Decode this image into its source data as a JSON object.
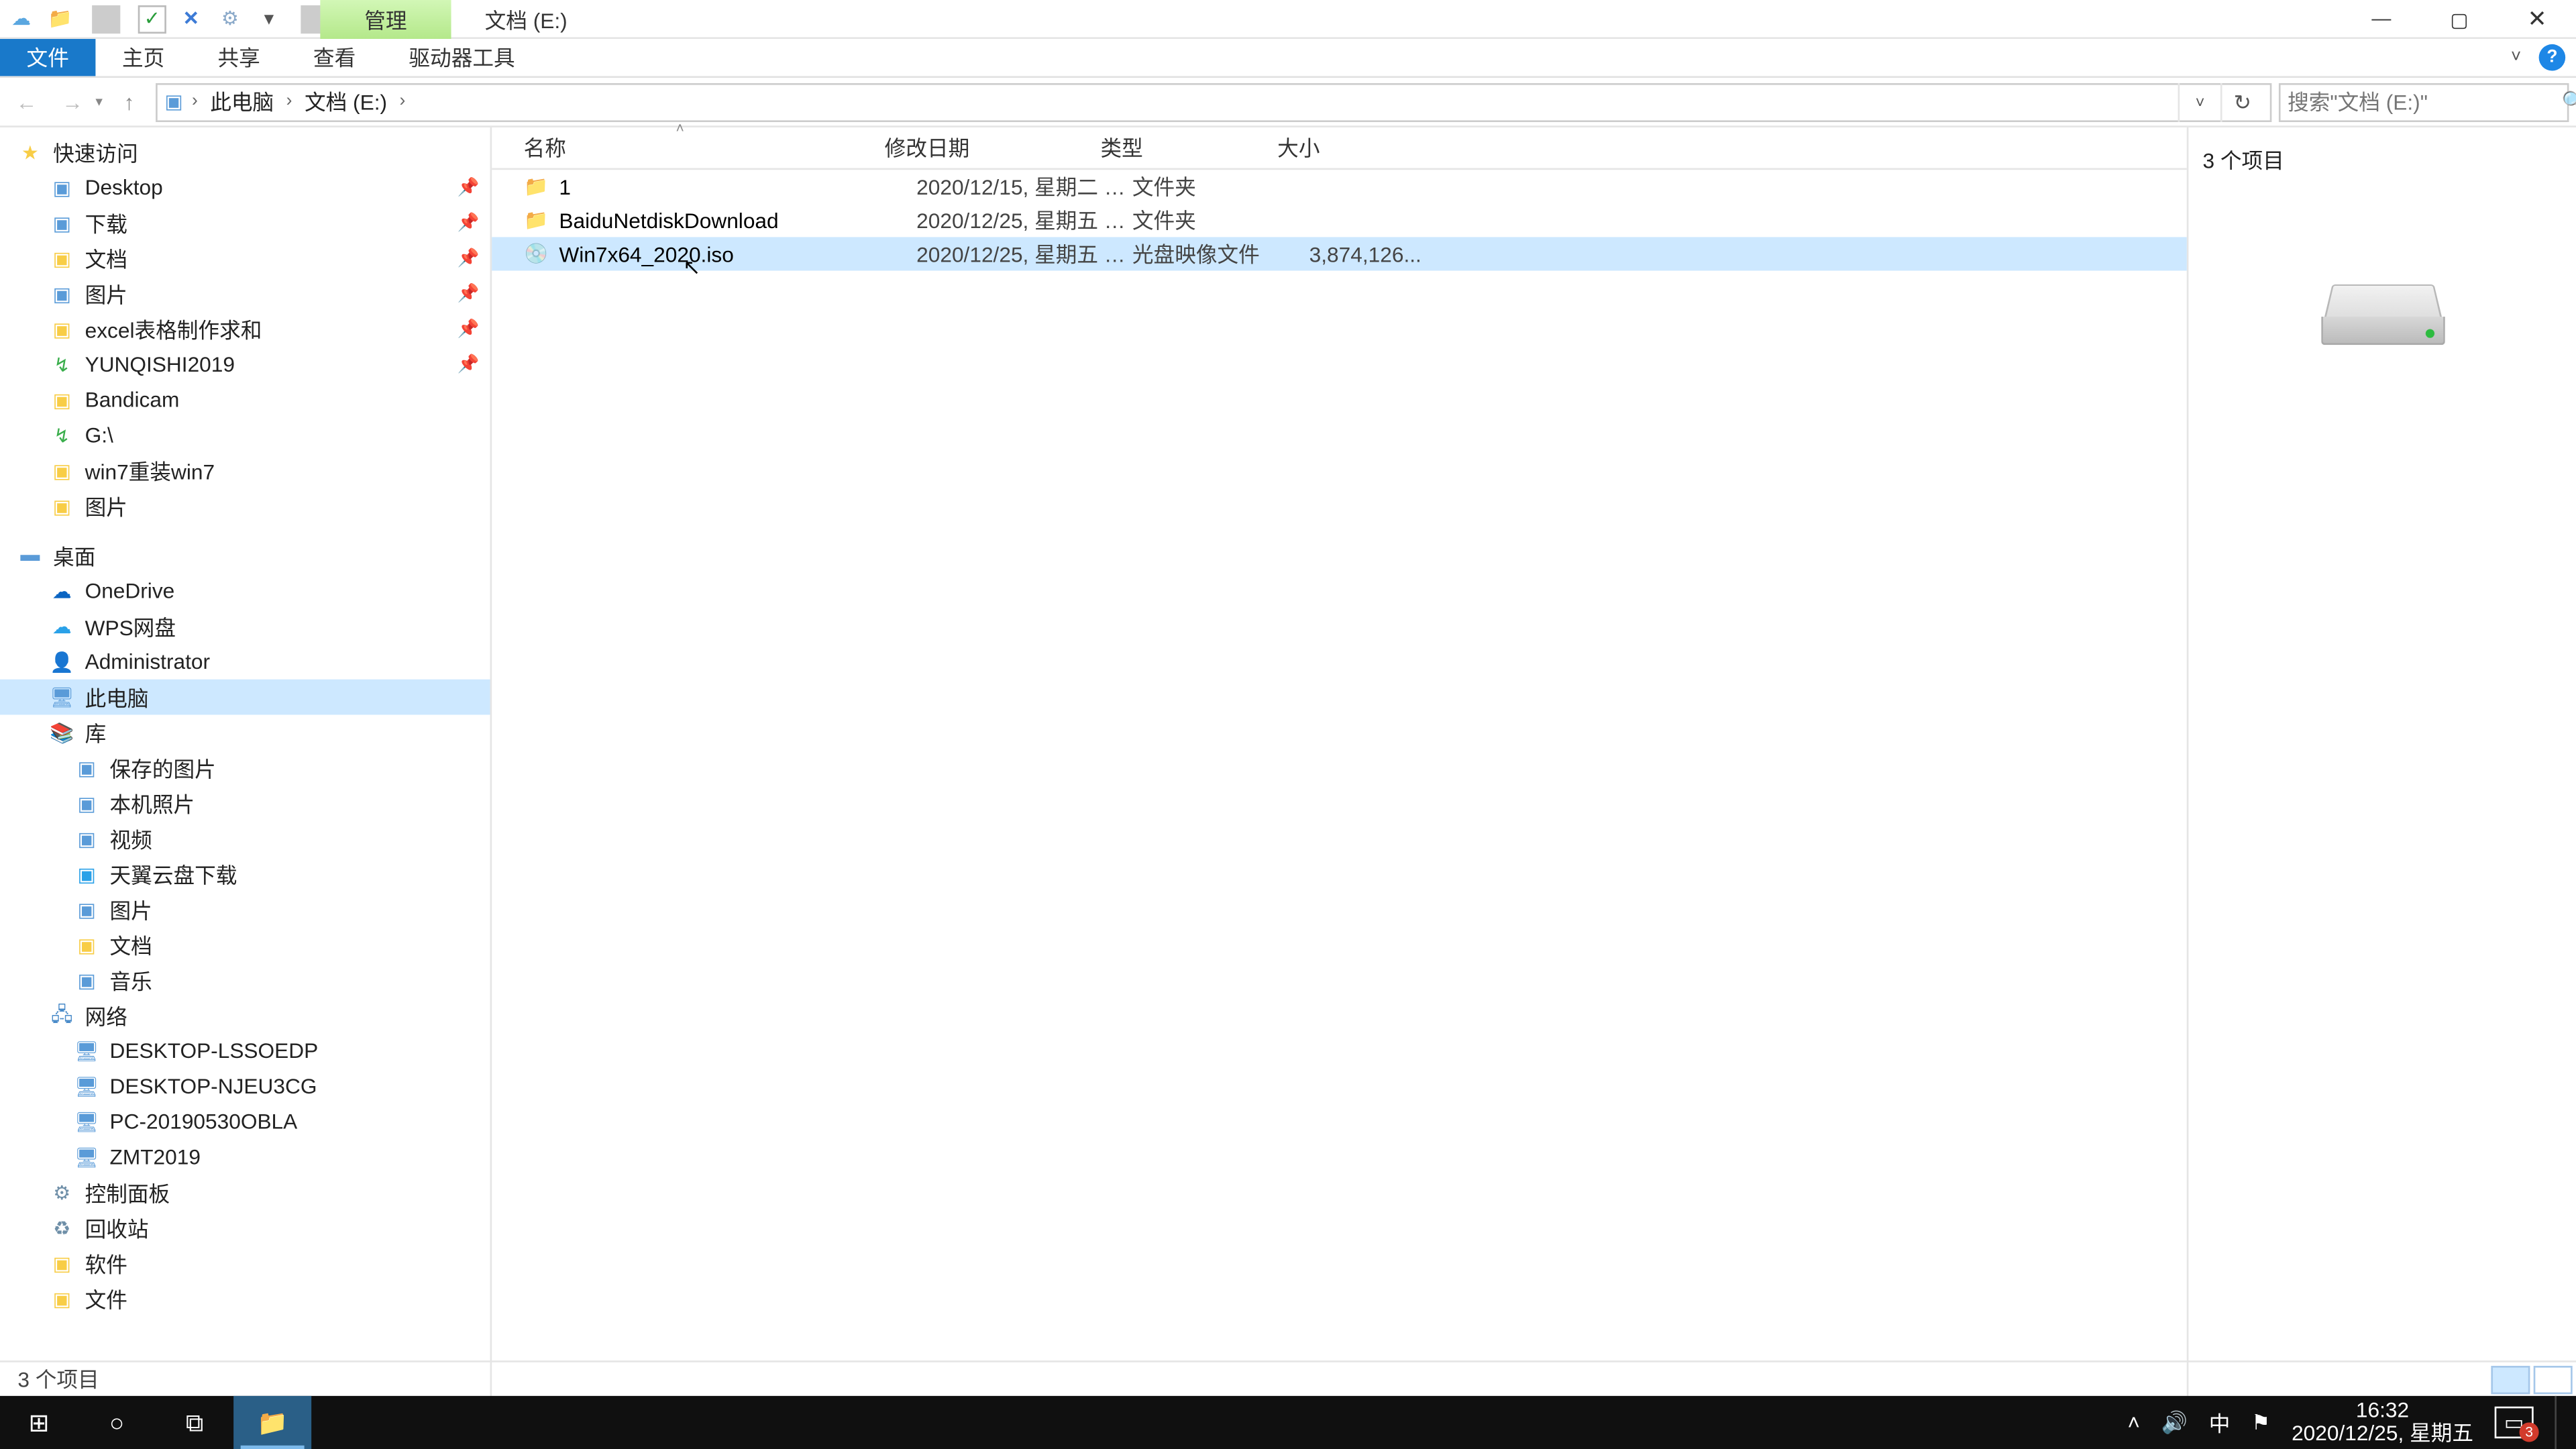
{
  "title": "文档 (E:)",
  "ribbon_context": "管理",
  "ribbon_tabs": {
    "file": "文件",
    "home": "主页",
    "share": "共享",
    "view": "查看",
    "drive": "驱动器工具"
  },
  "breadcrumb": {
    "root": "此电脑",
    "leaf": "文档 (E:)"
  },
  "search_placeholder": "搜索\"文档 (E:)\"",
  "columns": {
    "name": "名称",
    "date": "修改日期",
    "type": "类型",
    "size": "大小"
  },
  "files": [
    {
      "name": "1",
      "date": "2020/12/15, 星期二 1...",
      "type": "文件夹",
      "size": "",
      "icon": "folder",
      "sel": false
    },
    {
      "name": "BaiduNetdiskDownload",
      "date": "2020/12/25, 星期五 1...",
      "type": "文件夹",
      "size": "",
      "icon": "folder",
      "sel": false
    },
    {
      "name": "Win7x64_2020.iso",
      "date": "2020/12/25, 星期五 1...",
      "type": "光盘映像文件",
      "size": "3,874,126...",
      "icon": "iso",
      "sel": true
    }
  ],
  "preview_title": "3 个项目",
  "status_text": "3 个项目",
  "tree_quick": {
    "label": "快速访问",
    "items": [
      {
        "l": "Desktop",
        "i": "blue",
        "pin": true
      },
      {
        "l": "下载",
        "i": "blue",
        "pin": true
      },
      {
        "l": "文档",
        "i": "folder",
        "pin": true
      },
      {
        "l": "图片",
        "i": "blue",
        "pin": true
      },
      {
        "l": "excel表格制作求和",
        "i": "folder",
        "pin": true
      },
      {
        "l": "YUNQISHI2019",
        "i": "green",
        "pin": true
      },
      {
        "l": "Bandicam",
        "i": "folder",
        "pin": false
      },
      {
        "l": "G:\\",
        "i": "green",
        "pin": false
      },
      {
        "l": "win7重装win7",
        "i": "folder",
        "pin": false
      },
      {
        "l": "图片",
        "i": "folder",
        "pin": false
      }
    ]
  },
  "tree_desktop": {
    "label": "桌面",
    "items": [
      {
        "l": "OneDrive",
        "i": "cloud"
      },
      {
        "l": "WPS网盘",
        "i": "cloud2"
      },
      {
        "l": "Administrator",
        "i": "user"
      },
      {
        "l": "此电脑",
        "i": "pc",
        "sel": true
      },
      {
        "l": "库",
        "i": "lib"
      }
    ]
  },
  "tree_lib": [
    {
      "l": "保存的图片",
      "i": "blue"
    },
    {
      "l": "本机照片",
      "i": "blue"
    },
    {
      "l": "视频",
      "i": "blue"
    },
    {
      "l": "天翼云盘下载",
      "i": "cloud2"
    },
    {
      "l": "图片",
      "i": "blue"
    },
    {
      "l": "文档",
      "i": "folder"
    },
    {
      "l": "音乐",
      "i": "blue"
    }
  ],
  "tree_net": {
    "label": "网络",
    "items": [
      {
        "l": "DESKTOP-LSSOEDP"
      },
      {
        "l": "DESKTOP-NJEU3CG"
      },
      {
        "l": "PC-20190530OBLA"
      },
      {
        "l": "ZMT2019"
      }
    ]
  },
  "tree_tail": [
    {
      "l": "控制面板",
      "i": "panel"
    },
    {
      "l": "回收站",
      "i": "recycle"
    },
    {
      "l": "软件",
      "i": "folder"
    },
    {
      "l": "文件",
      "i": "folder"
    }
  ],
  "clock": {
    "time": "16:32",
    "date": "2020/12/25, 星期五"
  },
  "ime": "中",
  "action_count": "3"
}
